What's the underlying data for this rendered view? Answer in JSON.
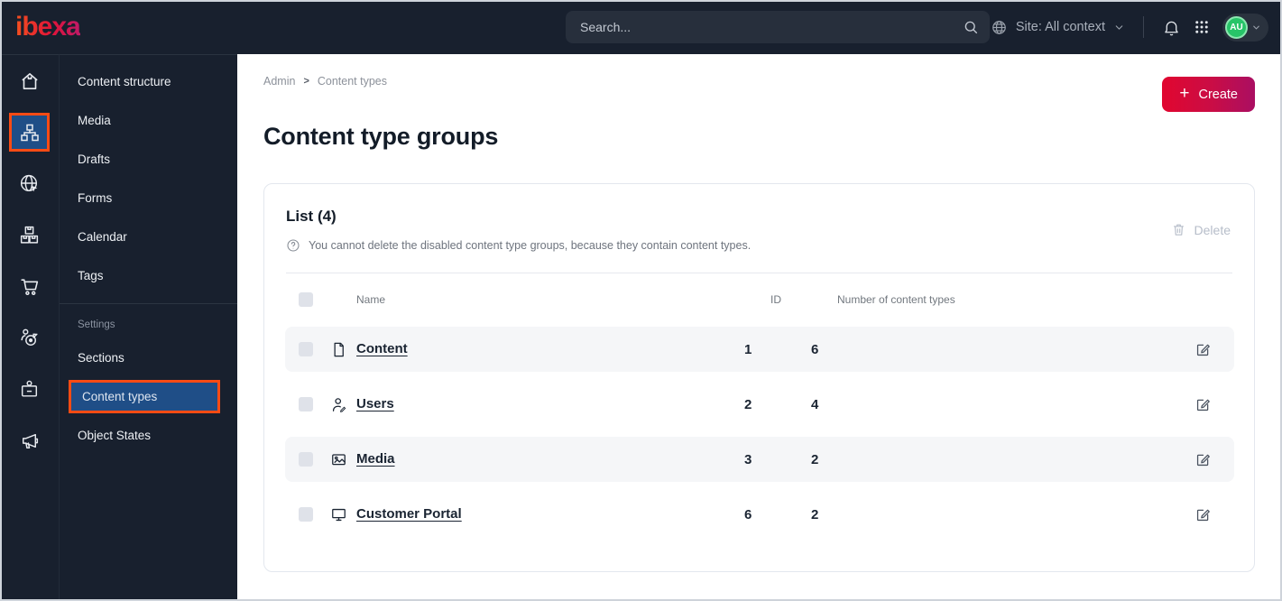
{
  "topbar": {
    "logo_text": "ibexa",
    "search_placeholder": "Search...",
    "site_label": "Site: All context",
    "avatar_initials": "AU"
  },
  "rail_icons": [
    "home-icon",
    "content-structure-sitemap-icon",
    "site-globe-icon",
    "products-boxes-icon",
    "commerce-cart-icon",
    "personalization-target-icon",
    "corporate-badge-icon",
    "marketing-megaphone-icon"
  ],
  "sidebar": {
    "items": [
      "Content structure",
      "Media",
      "Drafts",
      "Forms",
      "Calendar",
      "Tags"
    ],
    "settings_label": "Settings",
    "settings_items": [
      "Sections",
      "Content types",
      "Object States"
    ],
    "active_item": "Content types"
  },
  "breadcrumb": {
    "item1": "Admin",
    "separator": ">",
    "item2": "Content types"
  },
  "page": {
    "title": "Content type groups",
    "create_label": "Create"
  },
  "panel": {
    "title": "List (4)",
    "info": "You cannot delete the disabled content type groups, because they contain content types.",
    "delete_label": "Delete"
  },
  "table": {
    "headers": {
      "name": "Name",
      "id": "ID",
      "count": "Number of content types"
    },
    "rows": [
      {
        "name": "Content",
        "id": "1",
        "count": "6",
        "icon": "file-icon"
      },
      {
        "name": "Users",
        "id": "2",
        "count": "4",
        "icon": "user-icon"
      },
      {
        "name": "Media",
        "id": "3",
        "count": "2",
        "icon": "image-icon"
      },
      {
        "name": "Customer Portal",
        "id": "6",
        "count": "2",
        "icon": "monitor-icon"
      }
    ]
  },
  "colors": {
    "topbar_bg": "#18202e",
    "highlight_blue": "#1f4e87",
    "annotation_orange": "#fb4b14",
    "create_gradient_start": "#e1062f",
    "create_gradient_end": "#aa0e62",
    "avatar_green": "#27c468",
    "row_stripe": "#f5f6f8"
  }
}
